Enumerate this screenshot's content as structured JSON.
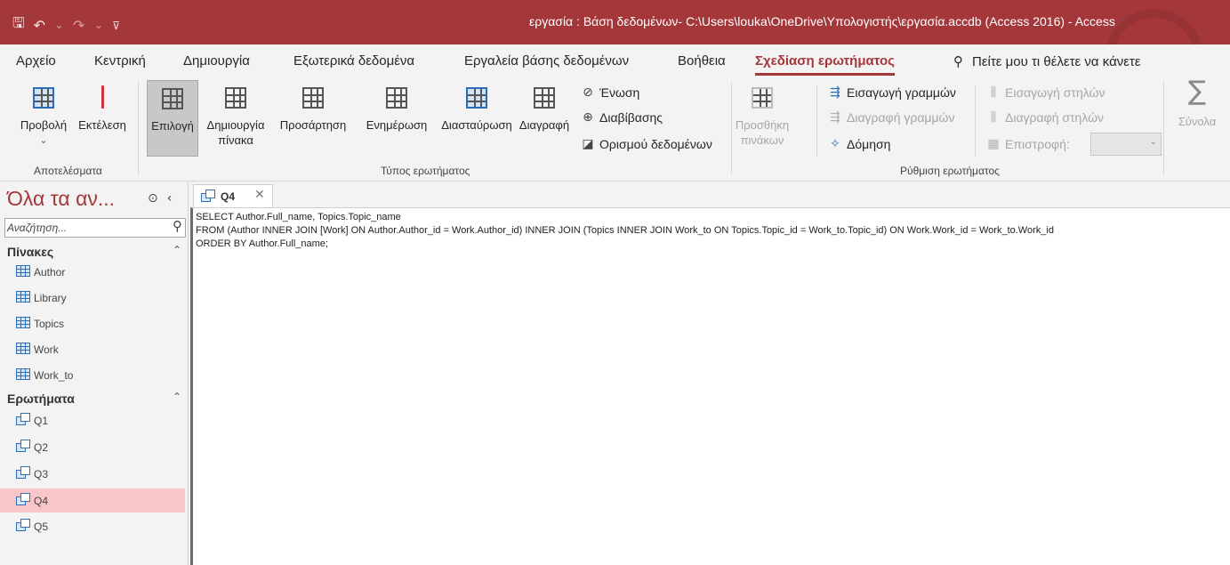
{
  "title_bar": {
    "window_title": "εργασία : Βάση δεδομένων- C:\\Users\\louka\\OneDrive\\Υπολογιστής\\εργασία.accdb (Access 2016)  -  Access",
    "qat": {
      "save_icon": "save-icon",
      "undo_icon": "undo-icon",
      "redo_icon": "redo-icon",
      "customize_icon": "customize-qat-icon"
    }
  },
  "menu": {
    "tabs": [
      {
        "label": "Αρχείο"
      },
      {
        "label": "Κεντρική"
      },
      {
        "label": "Δημιουργία"
      },
      {
        "label": "Εξωτερικά δεδομένα"
      },
      {
        "label": "Εργαλεία βάσης δεδομένων"
      },
      {
        "label": "Βοήθεια"
      },
      {
        "label": "Σχεδίαση ερωτήματος"
      }
    ],
    "active_tab": "Σχεδίαση ερωτήματος",
    "tell_me": "Πείτε μου τι θέλετε να κάνετε"
  },
  "ribbon": {
    "results": {
      "view_label": "Προβολή",
      "run_label": "Εκτέλεση",
      "group_label": "Αποτελέσματα"
    },
    "query_type": {
      "select_label": "Επιλογή",
      "make_table_label_1": "Δημιουργία",
      "make_table_label_2": "πίνακα",
      "append_label": "Προσάρτηση",
      "update_label": "Ενημέρωση",
      "crosstab_label": "Διασταύρωση",
      "delete_label": "Διαγραφή",
      "union_label": "Ένωση",
      "pass_through_label": "Διαβίβασης",
      "data_definition_label": "Ορισμού δεδομένων",
      "group_label": "Τύπος ερωτήματος"
    },
    "query_setup": {
      "show_table_label_1": "Προσθήκη",
      "show_table_label_2": "πινάκων",
      "insert_rows_label": "Εισαγωγή γραμμών",
      "delete_rows_label": "Διαγραφή γραμμών",
      "builder_label": "Δόμηση",
      "insert_columns_label": "Εισαγωγή στηλών",
      "delete_columns_label": "Διαγραφή στηλών",
      "return_label": "Επιστροφή:",
      "group_label": "Ρύθμιση ερωτήματος"
    },
    "totals_label": "Σύνολα"
  },
  "nav_pane": {
    "title": "Όλα τα αν...",
    "search_placeholder": "Αναζήτηση...",
    "tables_header": "Πίνακες",
    "tables": [
      "Author",
      "Library",
      "Topics",
      "Work",
      "Work_to"
    ],
    "queries_header": "Ερωτήματα",
    "queries": [
      "Q1",
      "Q2",
      "Q3",
      "Q4",
      "Q5"
    ],
    "selected_query": "Q4"
  },
  "document": {
    "tab_label": "Q4",
    "sql_lines": [
      "SELECT Author.Full_name, Topics.Topic_name",
      "FROM (Author INNER JOIN [Work] ON Author.Author_id = Work.Author_id) INNER JOIN (Topics INNER JOIN Work_to ON Topics.Topic_id = Work_to.Topic_id) ON Work.Work_id = Work_to.Work_id",
      "ORDER BY Author.Full_name;"
    ]
  },
  "colors": {
    "accent": "#a4373a",
    "selected_nav": "#f8c6c7",
    "ribbon_bg": "#f3f3f3"
  }
}
